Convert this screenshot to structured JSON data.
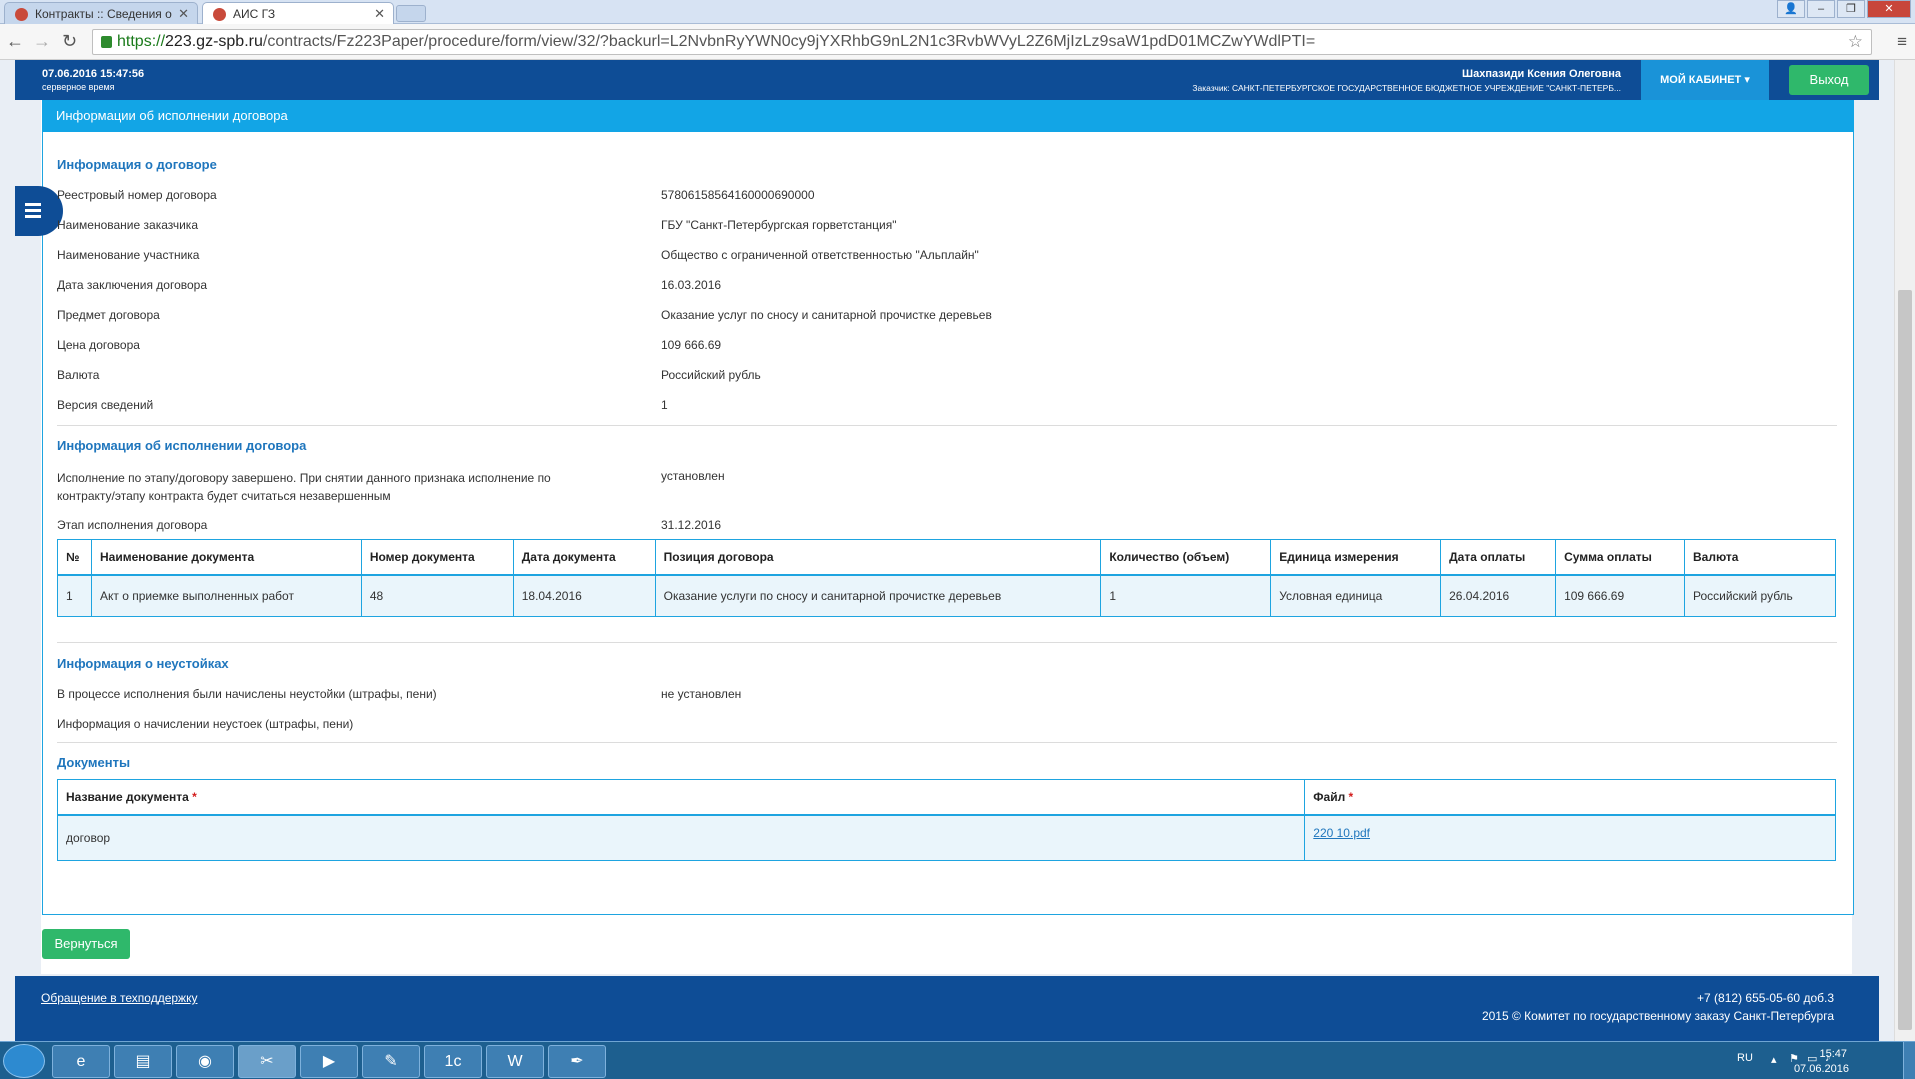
{
  "browser": {
    "tabs": [
      {
        "label": "Контракты :: Сведения о"
      },
      {
        "label": "АИС ГЗ"
      }
    ],
    "url_scheme": "https://",
    "url_host": "223.gz-spb.ru",
    "url_path": "/contracts/Fz223Paper/procedure/form/view/32/?backurl=L2NvbnRyYWN0cy9jYXRhbG9nL2N1c3RvbWVyL2Z6MjIzLz9saW1pdD01MCZwYWdlPTI="
  },
  "header": {
    "datetime": "07.06.2016 15:47:56",
    "datetime_note": "серверное время",
    "user_name": "Шахпазиди Ксения Олеговна",
    "customer": "Заказчик: САНКТ-ПЕТЕРБУРГСКОЕ ГОСУДАРСТВЕННОЕ БЮДЖЕТНОЕ УЧРЕЖДЕНИЕ \"САНКТ-ПЕТЕРБ...",
    "cabinet_label": "МОЙ КАБИНЕТ",
    "logout_label": "Выход"
  },
  "panel_title": "Информации об исполнении договора",
  "contract_info": {
    "title": "Информация о договоре",
    "rows": [
      {
        "label": "Реестровый номер договора",
        "value": "57806158564160000690000"
      },
      {
        "label": "Наименование заказчика",
        "value": "ГБУ \"Санкт-Петербургская горветстанция\""
      },
      {
        "label": "Наименование участника",
        "value": "Общество с ограниченной ответственностью \"Альплайн\""
      },
      {
        "label": "Дата заключения договора",
        "value": "16.03.2016"
      },
      {
        "label": "Предмет договора",
        "value": "Оказание услуг по сносу и санитарной прочистке деревьев"
      },
      {
        "label": "Цена договора",
        "value": "109 666.69"
      },
      {
        "label": "Валюта",
        "value": "Российский рубль"
      },
      {
        "label": "Версия сведений",
        "value": "1"
      }
    ]
  },
  "execution_info": {
    "title": "Информация об исполнении договора",
    "completed_label_line1": "Исполнение по этапу/договору завершено. При снятии данного признака исполнение по",
    "completed_label_line2": "контракту/этапу контракта будет считаться незавершенным",
    "completed_value": "установлен",
    "stage_label": "Этап исполнения договора",
    "stage_value": "31.12.2016",
    "table": {
      "headers": [
        "№",
        "Наименование документа",
        "Номер документа",
        "Дата документа",
        "Позиция договора",
        "Количество (объем)",
        "Единица измерения",
        "Дата оплаты",
        "Сумма оплаты",
        "Валюта"
      ],
      "rows": [
        [
          "1",
          "Акт о приемке выполненных работ",
          "48",
          "18.04.2016",
          "Оказание услуги по сносу и санитарной прочистке деревьев",
          "1",
          "Условная единица",
          "26.04.2016",
          "109 666.69",
          "Российский рубль"
        ]
      ]
    }
  },
  "penalty_info": {
    "title": "Информация о неустойках",
    "rows": [
      {
        "label": "В процессе исполнения были начислены неустойки (штрафы, пени)",
        "value": "не установлен"
      },
      {
        "label": "Информация о начислении неустоек (штрафы, пени)",
        "value": ""
      }
    ]
  },
  "documents": {
    "title": "Документы",
    "headers": [
      "Название документа",
      "Файл"
    ],
    "required_mark": "*",
    "rows": [
      {
        "name": "договор",
        "file": "220 10.pdf"
      }
    ]
  },
  "back_label": "Вернуться",
  "footer": {
    "support_link": "Обращение в техподдержку",
    "phone": "+7 (812) 655-05-60 доб.3",
    "copyright": "2015 © Комитет по государственному заказу Санкт-Петербурга"
  },
  "taskbar": {
    "lang": "RU",
    "time": "15:47",
    "date": "07.06.2016",
    "apps": [
      "ie-icon",
      "explorer-icon",
      "chrome-icon",
      "app-icon",
      "media-icon",
      "tools-icon",
      "1c-icon",
      "word-icon",
      "acrobat-icon"
    ],
    "app_1c_glyph": "1с",
    "app_word_glyph": "W"
  }
}
